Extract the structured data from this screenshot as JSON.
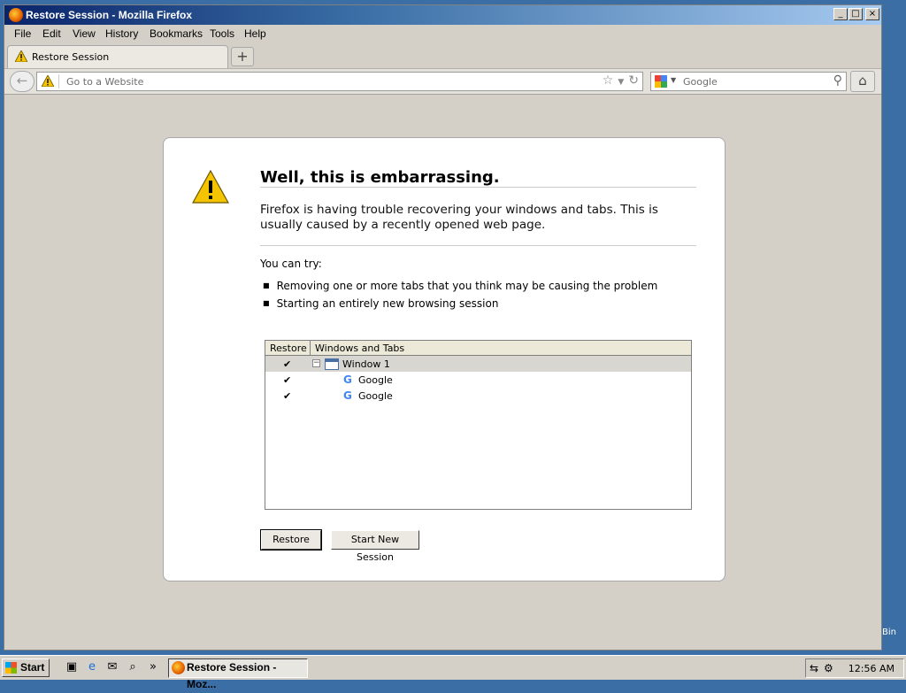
{
  "window": {
    "title": "Restore Session - Mozilla Firefox"
  },
  "menu": [
    "File",
    "Edit",
    "View",
    "History",
    "Bookmarks",
    "Tools",
    "Help"
  ],
  "tab": {
    "label": "Restore Session",
    "new_tab": "+"
  },
  "nav": {
    "back": "←",
    "url_placeholder": "Go to a Website",
    "search_placeholder": "Google",
    "home": "⌂"
  },
  "page": {
    "title": "Well, this is embarrassing.",
    "description": "Firefox is having trouble recovering your windows and tabs. This is usually caused by a recently opened web page.",
    "you_can_try": "You can try:",
    "suggestions": [
      "Removing one or more tabs that you think may be causing the problem",
      "Starting an entirely new browsing session"
    ],
    "tree": {
      "col_restore": "Restore",
      "col_windows": "Windows and Tabs",
      "rows": [
        {
          "checked": "✔",
          "label": "Window 1",
          "expander": "−",
          "favicon": "window-icon"
        },
        {
          "checked": "✔",
          "label": "Google",
          "favicon": "google-icon"
        },
        {
          "checked": "✔",
          "label": "Google",
          "favicon": "google-icon"
        }
      ]
    },
    "buttons": {
      "restore": "Restore",
      "new_session": "Start New Session"
    }
  },
  "taskbar": {
    "start": "Start",
    "task": "Restore Session - Moz...",
    "chevron": "»",
    "clock": "12:56 AM"
  },
  "desktop": {
    "partial_label": "Bin"
  },
  "colors": {
    "titlebar": "#0a246a",
    "accent_google": "#4285f4"
  }
}
